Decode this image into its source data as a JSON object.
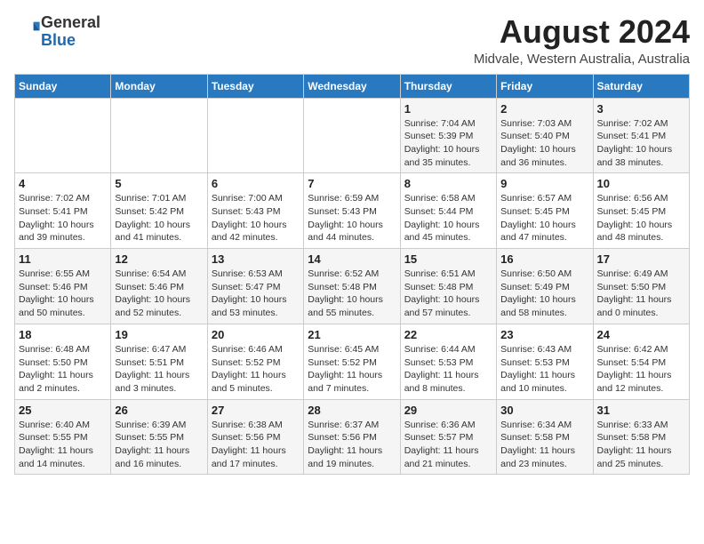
{
  "header": {
    "logo_general": "General",
    "logo_blue": "Blue",
    "month_year": "August 2024",
    "location": "Midvale, Western Australia, Australia"
  },
  "days_of_week": [
    "Sunday",
    "Monday",
    "Tuesday",
    "Wednesday",
    "Thursday",
    "Friday",
    "Saturday"
  ],
  "weeks": [
    [
      {
        "day": "",
        "info": ""
      },
      {
        "day": "",
        "info": ""
      },
      {
        "day": "",
        "info": ""
      },
      {
        "day": "",
        "info": ""
      },
      {
        "day": "1",
        "info": "Sunrise: 7:04 AM\nSunset: 5:39 PM\nDaylight: 10 hours\nand 35 minutes."
      },
      {
        "day": "2",
        "info": "Sunrise: 7:03 AM\nSunset: 5:40 PM\nDaylight: 10 hours\nand 36 minutes."
      },
      {
        "day": "3",
        "info": "Sunrise: 7:02 AM\nSunset: 5:41 PM\nDaylight: 10 hours\nand 38 minutes."
      }
    ],
    [
      {
        "day": "4",
        "info": "Sunrise: 7:02 AM\nSunset: 5:41 PM\nDaylight: 10 hours\nand 39 minutes."
      },
      {
        "day": "5",
        "info": "Sunrise: 7:01 AM\nSunset: 5:42 PM\nDaylight: 10 hours\nand 41 minutes."
      },
      {
        "day": "6",
        "info": "Sunrise: 7:00 AM\nSunset: 5:43 PM\nDaylight: 10 hours\nand 42 minutes."
      },
      {
        "day": "7",
        "info": "Sunrise: 6:59 AM\nSunset: 5:43 PM\nDaylight: 10 hours\nand 44 minutes."
      },
      {
        "day": "8",
        "info": "Sunrise: 6:58 AM\nSunset: 5:44 PM\nDaylight: 10 hours\nand 45 minutes."
      },
      {
        "day": "9",
        "info": "Sunrise: 6:57 AM\nSunset: 5:45 PM\nDaylight: 10 hours\nand 47 minutes."
      },
      {
        "day": "10",
        "info": "Sunrise: 6:56 AM\nSunset: 5:45 PM\nDaylight: 10 hours\nand 48 minutes."
      }
    ],
    [
      {
        "day": "11",
        "info": "Sunrise: 6:55 AM\nSunset: 5:46 PM\nDaylight: 10 hours\nand 50 minutes."
      },
      {
        "day": "12",
        "info": "Sunrise: 6:54 AM\nSunset: 5:46 PM\nDaylight: 10 hours\nand 52 minutes."
      },
      {
        "day": "13",
        "info": "Sunrise: 6:53 AM\nSunset: 5:47 PM\nDaylight: 10 hours\nand 53 minutes."
      },
      {
        "day": "14",
        "info": "Sunrise: 6:52 AM\nSunset: 5:48 PM\nDaylight: 10 hours\nand 55 minutes."
      },
      {
        "day": "15",
        "info": "Sunrise: 6:51 AM\nSunset: 5:48 PM\nDaylight: 10 hours\nand 57 minutes."
      },
      {
        "day": "16",
        "info": "Sunrise: 6:50 AM\nSunset: 5:49 PM\nDaylight: 10 hours\nand 58 minutes."
      },
      {
        "day": "17",
        "info": "Sunrise: 6:49 AM\nSunset: 5:50 PM\nDaylight: 11 hours\nand 0 minutes."
      }
    ],
    [
      {
        "day": "18",
        "info": "Sunrise: 6:48 AM\nSunset: 5:50 PM\nDaylight: 11 hours\nand 2 minutes."
      },
      {
        "day": "19",
        "info": "Sunrise: 6:47 AM\nSunset: 5:51 PM\nDaylight: 11 hours\nand 3 minutes."
      },
      {
        "day": "20",
        "info": "Sunrise: 6:46 AM\nSunset: 5:52 PM\nDaylight: 11 hours\nand 5 minutes."
      },
      {
        "day": "21",
        "info": "Sunrise: 6:45 AM\nSunset: 5:52 PM\nDaylight: 11 hours\nand 7 minutes."
      },
      {
        "day": "22",
        "info": "Sunrise: 6:44 AM\nSunset: 5:53 PM\nDaylight: 11 hours\nand 8 minutes."
      },
      {
        "day": "23",
        "info": "Sunrise: 6:43 AM\nSunset: 5:53 PM\nDaylight: 11 hours\nand 10 minutes."
      },
      {
        "day": "24",
        "info": "Sunrise: 6:42 AM\nSunset: 5:54 PM\nDaylight: 11 hours\nand 12 minutes."
      }
    ],
    [
      {
        "day": "25",
        "info": "Sunrise: 6:40 AM\nSunset: 5:55 PM\nDaylight: 11 hours\nand 14 minutes."
      },
      {
        "day": "26",
        "info": "Sunrise: 6:39 AM\nSunset: 5:55 PM\nDaylight: 11 hours\nand 16 minutes."
      },
      {
        "day": "27",
        "info": "Sunrise: 6:38 AM\nSunset: 5:56 PM\nDaylight: 11 hours\nand 17 minutes."
      },
      {
        "day": "28",
        "info": "Sunrise: 6:37 AM\nSunset: 5:56 PM\nDaylight: 11 hours\nand 19 minutes."
      },
      {
        "day": "29",
        "info": "Sunrise: 6:36 AM\nSunset: 5:57 PM\nDaylight: 11 hours\nand 21 minutes."
      },
      {
        "day": "30",
        "info": "Sunrise: 6:34 AM\nSunset: 5:58 PM\nDaylight: 11 hours\nand 23 minutes."
      },
      {
        "day": "31",
        "info": "Sunrise: 6:33 AM\nSunset: 5:58 PM\nDaylight: 11 hours\nand 25 minutes."
      }
    ]
  ]
}
